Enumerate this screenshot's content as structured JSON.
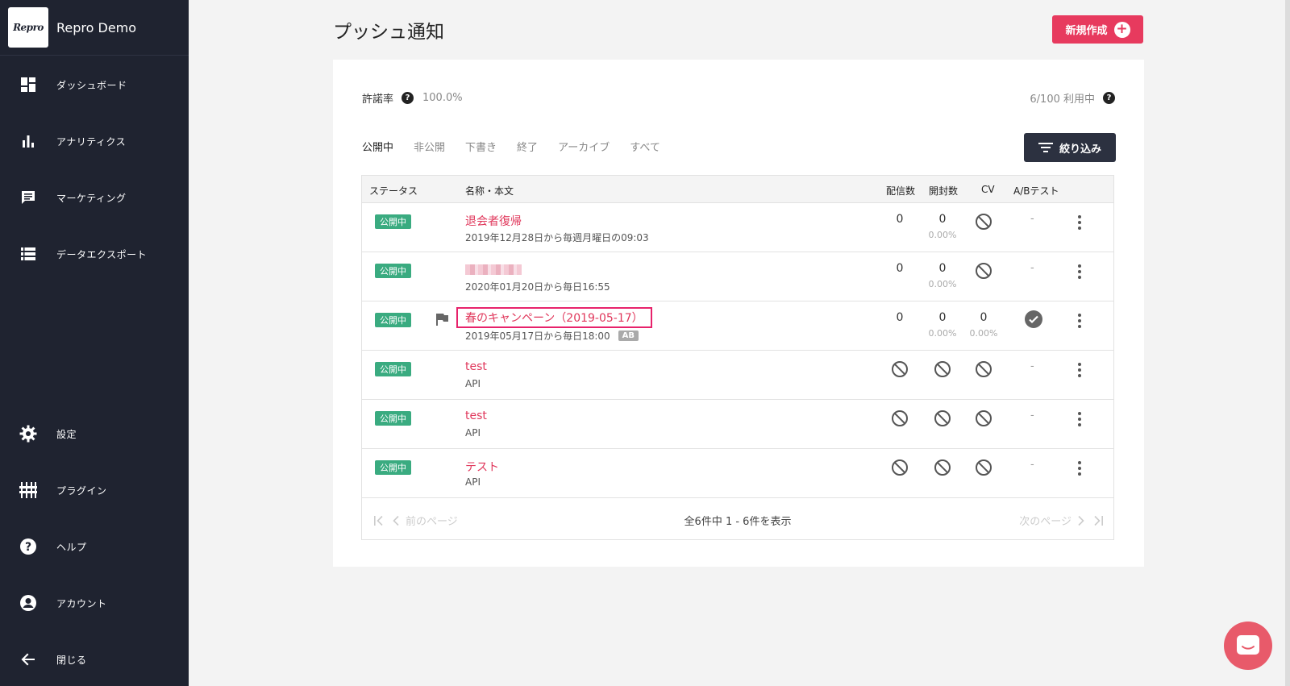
{
  "app": {
    "logo": "Repro",
    "name": "Repro Demo"
  },
  "sidebar": {
    "items": [
      {
        "label": "ダッシュボード",
        "icon": "dashboard-icon"
      },
      {
        "label": "アナリティクス",
        "icon": "bar-chart-icon"
      },
      {
        "label": "マーケティング",
        "icon": "chat-bubble-icon"
      },
      {
        "label": "データエクスポート",
        "icon": "list-icon"
      },
      {
        "label": "設定",
        "icon": "gear-icon"
      },
      {
        "label": "プラグイン",
        "icon": "sliders-icon"
      },
      {
        "label": "ヘルプ",
        "icon": "help-icon"
      },
      {
        "label": "アカウント",
        "icon": "account-icon"
      },
      {
        "label": "閉じる",
        "icon": "arrow-left-icon"
      }
    ]
  },
  "header": {
    "title": "プッシュ通知",
    "new_button": "新規作成"
  },
  "stats": {
    "permission_label": "許諾率",
    "permission_value": "100.0%",
    "usage": "6/100 利用中"
  },
  "tabs": [
    "公開中",
    "非公開",
    "下書き",
    "終了",
    "アーカイブ",
    "すべて"
  ],
  "filter_button": "絞り込み",
  "table": {
    "headers": {
      "status": "ステータス",
      "name": "名称・本文",
      "sent": "配信数",
      "opened": "開封数",
      "cv": "CV",
      "ab": "A/Bテスト"
    },
    "rows": [
      {
        "status": "公開中",
        "name": "退会者復帰",
        "sub": "2019年12月28日から毎週月曜日の09:03",
        "sent": "0",
        "opened": "0",
        "opened_pct": "0.00%",
        "cv": null,
        "ab": "-"
      },
      {
        "status": "公開中",
        "name": "",
        "sub": "2020年01月20日から毎日16:55",
        "sent": "0",
        "opened": "0",
        "opened_pct": "0.00%",
        "cv": null,
        "ab": "-"
      },
      {
        "status": "公開中",
        "name": "春のキャンペーン（2019-05-17）",
        "sub": "2019年05月17日から毎日18:00",
        "sub_badge": "AB",
        "sent": "0",
        "opened": "0",
        "opened_pct": "0.00%",
        "cv": "0",
        "cv_pct": "0.00%",
        "ab": "check"
      },
      {
        "status": "公開中",
        "name": "test",
        "sub": "API",
        "ab": "-"
      },
      {
        "status": "公開中",
        "name": "test",
        "sub": "API",
        "ab": "-"
      },
      {
        "status": "公開中",
        "name": "テスト",
        "sub": "API",
        "ab": "-"
      }
    ]
  },
  "pager": {
    "prev": "前のページ",
    "info": "全6件中 1 - 6件を表示",
    "next": "次のページ"
  },
  "colors": {
    "accent": "#e73a5e",
    "sidebar": "#1f2330",
    "badge": "#3aab80",
    "highlight": "#e7226b"
  }
}
